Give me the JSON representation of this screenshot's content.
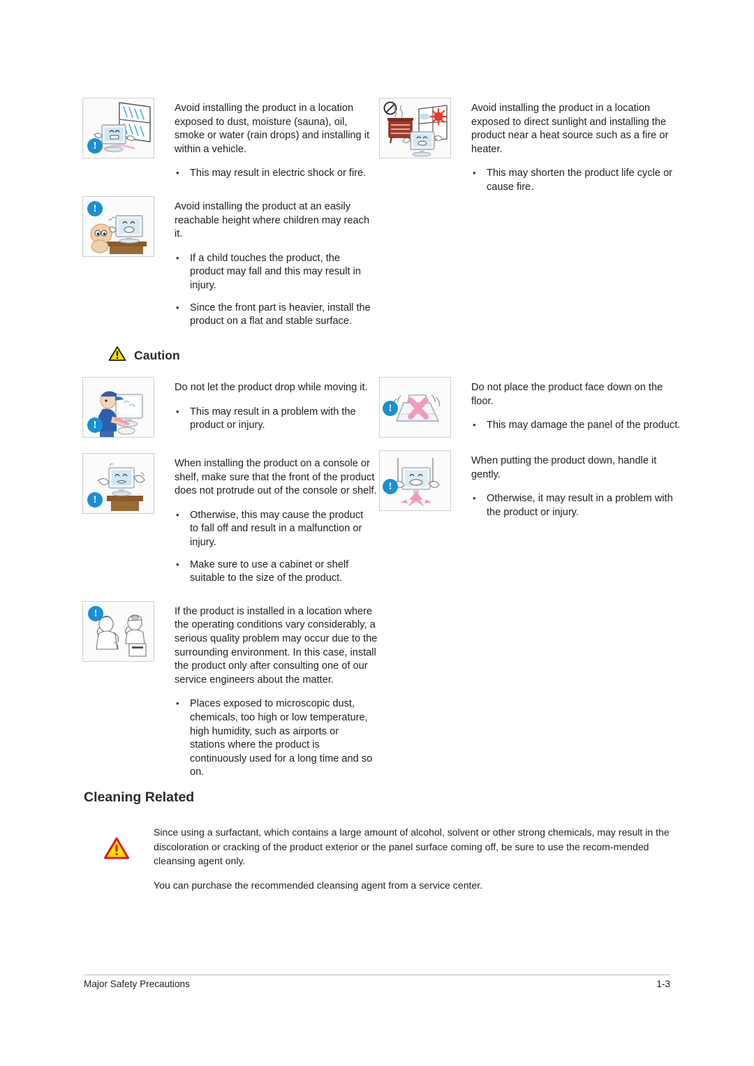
{
  "document": {
    "footer": {
      "left": "Major Safety Precautions",
      "right": "1-3"
    }
  },
  "warning_section": {
    "left_entries": [
      {
        "icon": "monitor-rain-window-icon",
        "lead": "Avoid installing the product in a location exposed to dust, moisture (sauna), oil, smoke or water (rain drops) and installing it within a vehicle.",
        "bullets": [
          "This may result in electric shock or fire."
        ]
      },
      {
        "icon": "child-reaching-monitor-icon",
        "lead": "Avoid installing the product at an easily reachable height where children may reach it.",
        "bullets": [
          "If a child touches the product, the product may fall and this may result in injury.",
          "Since the front part is heavier, install the product on a flat and stable surface."
        ]
      }
    ],
    "right_entries": [
      {
        "icon": "heater-sunlight-monitor-icon",
        "lead": "Avoid installing the product in a location exposed to direct sunlight and installing the product near a heat source such as a fire or heater.",
        "bullets": [
          "This may shorten the product life cycle or cause fire."
        ]
      }
    ]
  },
  "caution": {
    "heading": "Caution",
    "icon": "yellow-warning-triangle-icon",
    "left_entries": [
      {
        "icon": "worker-carrying-monitor-icon",
        "lead": "Do not let the product drop while moving it.",
        "bullets": [
          "This may result in a problem with the product or injury."
        ]
      },
      {
        "icon": "monitor-on-shelf-icon",
        "lead": "When installing the product on a console or shelf, make sure that the front of the product does not protrude out of the console or shelf.",
        "bullets": [
          "Otherwise, this may cause the product to fall off and result in a malfunction or injury.",
          "Make sure to use a cabinet or shelf suitable to the size of the product."
        ]
      },
      {
        "icon": "service-engineer-phone-icon",
        "lead": "If the product is installed in a location where the operating conditions vary considerably, a serious quality problem may occur due to the surrounding environment. In this case, install the product only after consulting one of our service engineers about the matter.",
        "bullets": [
          "Places exposed to microscopic dust, chemicals, too high or low temperature, high humidity, such as airports or stations where the product is continuously used for a long time and so on."
        ]
      }
    ],
    "right_entries": [
      {
        "icon": "monitor-face-down-x-icon",
        "lead": "Do not place the product face down on the floor.",
        "bullets": [
          "This may damage the panel of the product."
        ]
      },
      {
        "icon": "monitor-handle-gently-icon",
        "lead": "When putting the product down, handle it gently.",
        "bullets": [
          "Otherwise, it may result in a problem with the product or injury."
        ]
      }
    ]
  },
  "cleaning": {
    "heading": "Cleaning Related",
    "icon": "red-warning-triangle-icon",
    "paragraph_1": "Since using a surfactant, which contains a large amount of alcohol, solvent or other strong chemicals, may result in the discoloration or cracking of the product exterior or the panel surface coming off, be sure to use the recom-mended cleansing agent only.",
    "paragraph_2": "You can purchase the recommended cleansing agent from a service center."
  },
  "colors": {
    "badge_blue": "#1b8fd0",
    "caution_yellow": "#ffe000",
    "warning_red": "#e01b1b",
    "pink_x": "#f49ac1",
    "footer_rule": "#b9b9cf"
  }
}
